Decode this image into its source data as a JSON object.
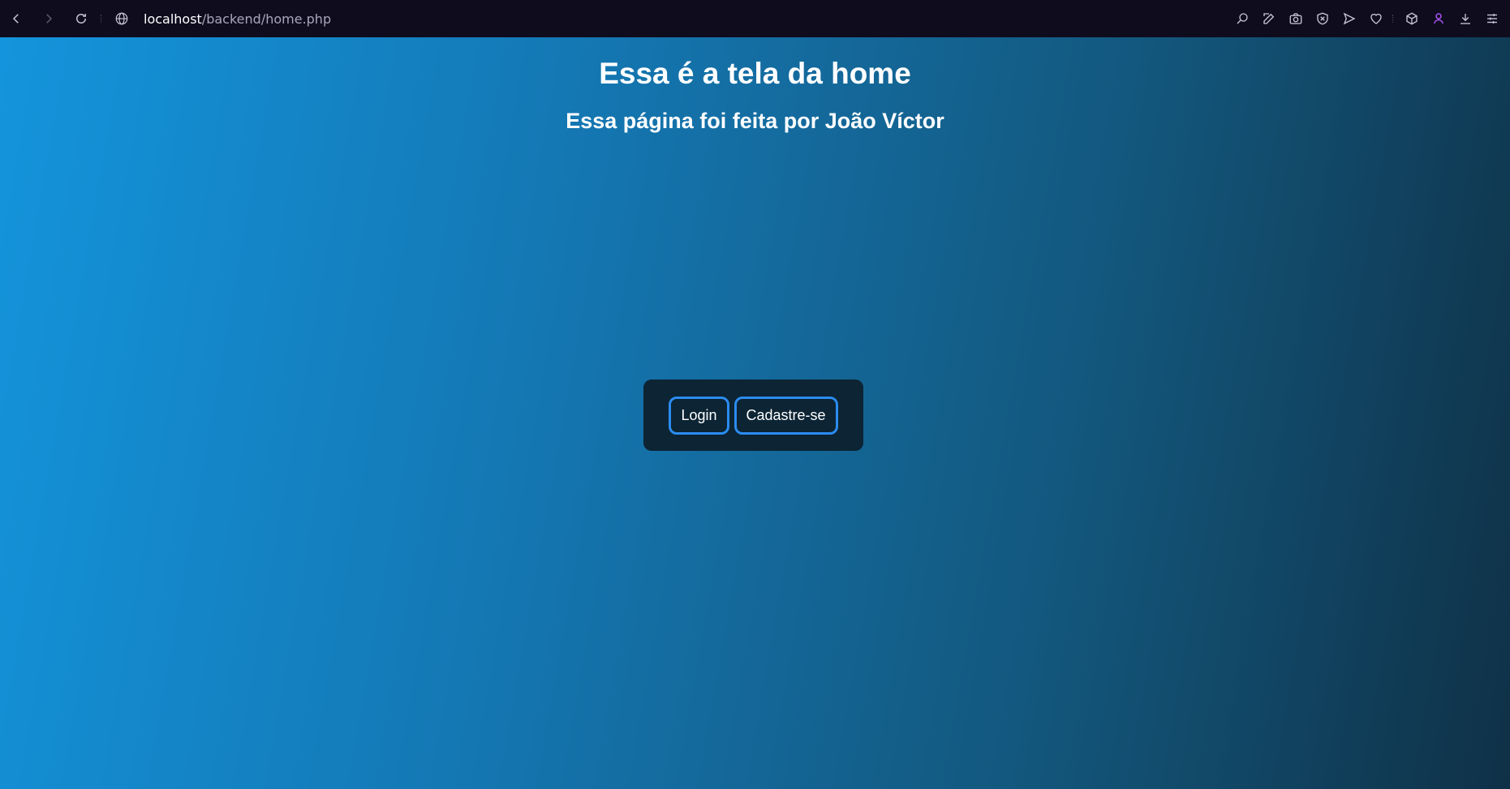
{
  "browser": {
    "url_host": "localhost",
    "url_path": "/backend/home.php",
    "toolbar_icons": [
      "search-icon",
      "edit-icon",
      "camera-icon",
      "shield-icon",
      "send-icon",
      "heart-icon",
      "cube-icon",
      "profile-icon",
      "download-icon",
      "settings-icon"
    ]
  },
  "page": {
    "title": "Essa é a tela da home",
    "subtitle": "Essa página foi feita por João Víctor",
    "buttons": {
      "login": "Login",
      "signup": "Cadastre-se"
    }
  },
  "colors": {
    "gradient_start": "#1494dc",
    "gradient_end": "#0f3147",
    "button_border": "#2b8cf0",
    "box_background": "#0c2434",
    "accent_icon": "#a855f7"
  }
}
